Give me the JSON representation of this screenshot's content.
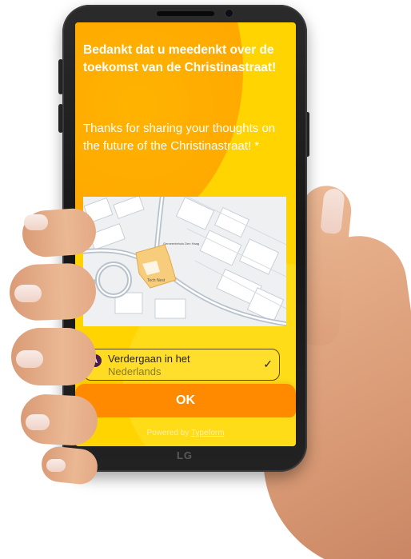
{
  "device": {
    "brand": "LG"
  },
  "screen": {
    "heading": "Bedankt dat u meedenkt over de toekomst van de Christinastraat!",
    "subheading": "Thanks for sharing your thoughts on the future of the Christinastraat! *",
    "map": {
      "building_label": "Tech Nest",
      "place_label": "Gemeentehuis Den Haag"
    },
    "choice": {
      "key": "A",
      "label_line1": "Verdergaan in het",
      "label_line2": "Nederlands",
      "selected": true
    },
    "ok_button": "OK",
    "powered_by_prefix": "Powered by",
    "powered_by_brand": "Typeform"
  },
  "colors": {
    "screen_yellow": "#ffd400",
    "screen_orange": "#ffa600",
    "button_orange": "#ff8a00",
    "key_purple": "#4a1e4a"
  }
}
